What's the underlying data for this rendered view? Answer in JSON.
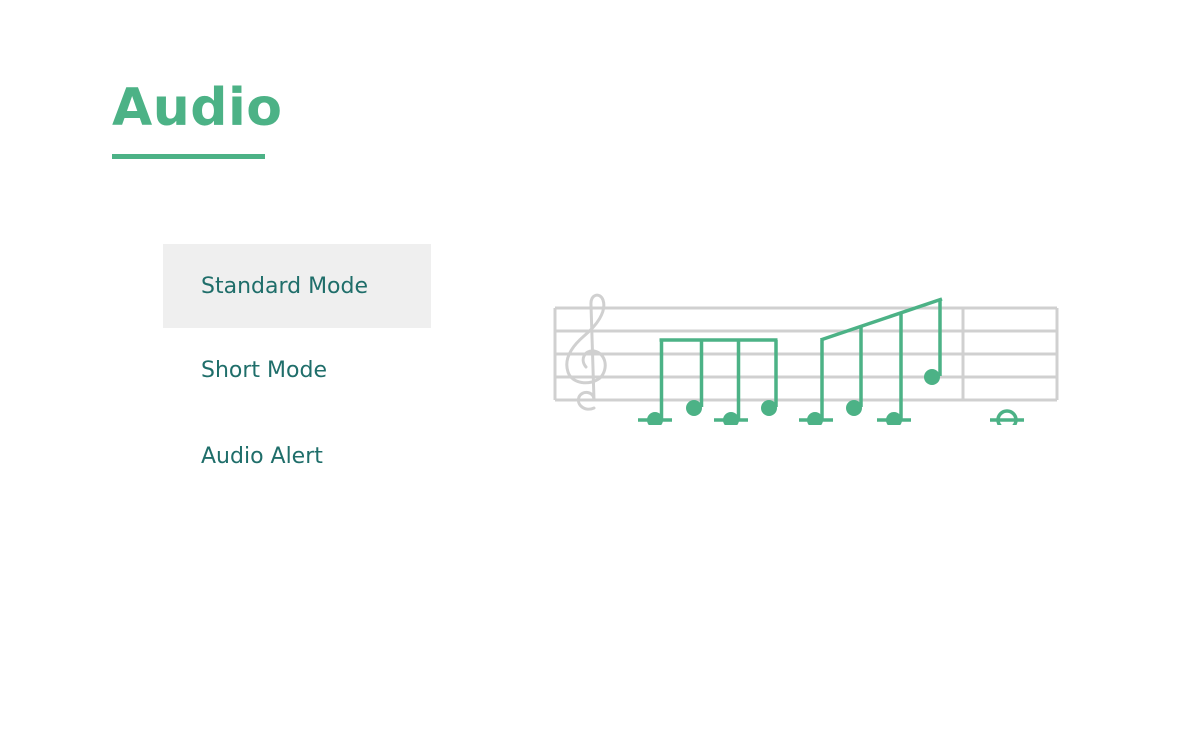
{
  "page": {
    "title": "Audio"
  },
  "modes": {
    "selected_index": 0,
    "items": [
      {
        "label": "Standard Mode",
        "selected": true
      },
      {
        "label": "Short Mode",
        "selected": false
      },
      {
        "label": "Audio Alert",
        "selected": false
      }
    ]
  },
  "illustration": {
    "icon": "music-notation-illustration",
    "accent_color": "#4cb286",
    "staff_color": "#d0d0d0"
  },
  "colors": {
    "accent": "#4cb286",
    "text": "#1f6e6a",
    "selected_bg": "#efefef"
  }
}
